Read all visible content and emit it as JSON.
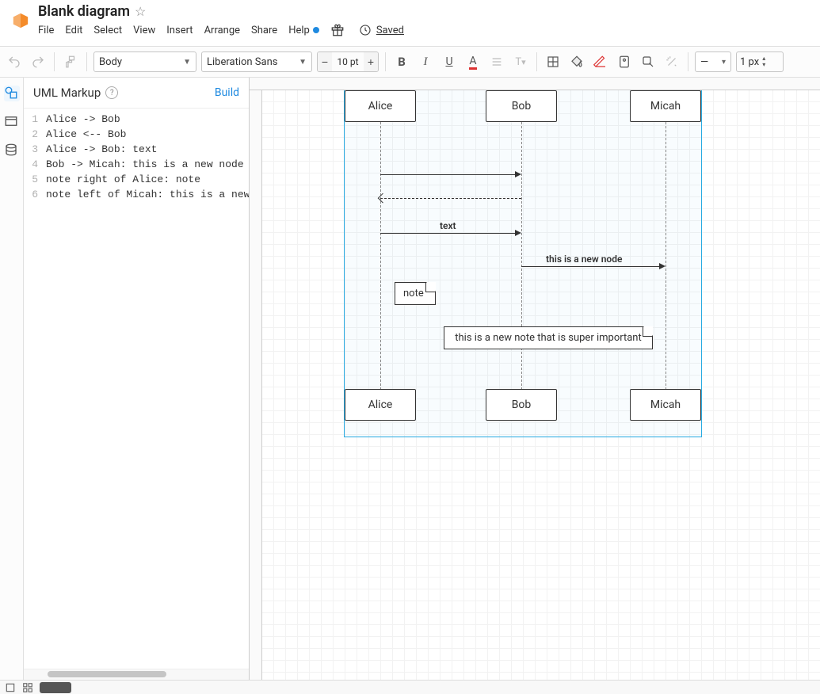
{
  "header": {
    "title": "Blank diagram",
    "menu": [
      "File",
      "Edit",
      "Select",
      "View",
      "Insert",
      "Arrange",
      "Share",
      "Help"
    ],
    "saved": "Saved"
  },
  "toolbar": {
    "block_style": "Body",
    "font_family": "Liberation Sans",
    "font_size": "10 pt",
    "line_style": "———",
    "line_width": "1 px"
  },
  "sidebar": {
    "title": "UML Markup",
    "build": "Build",
    "lines": [
      "Alice -> Bob",
      "Alice <-- Bob",
      "Alice -> Bob: text",
      "Bob -> Micah: this is a new node",
      "note right of Alice: note",
      "note left of Micah: this is a new n"
    ]
  },
  "diagram": {
    "actors": [
      "Alice",
      "Bob",
      "Micah"
    ],
    "messages": {
      "m3_label": "text",
      "m4_label": "this is a new node"
    },
    "notes": {
      "n1": "note",
      "n2": "this is a new note that is super important"
    }
  }
}
